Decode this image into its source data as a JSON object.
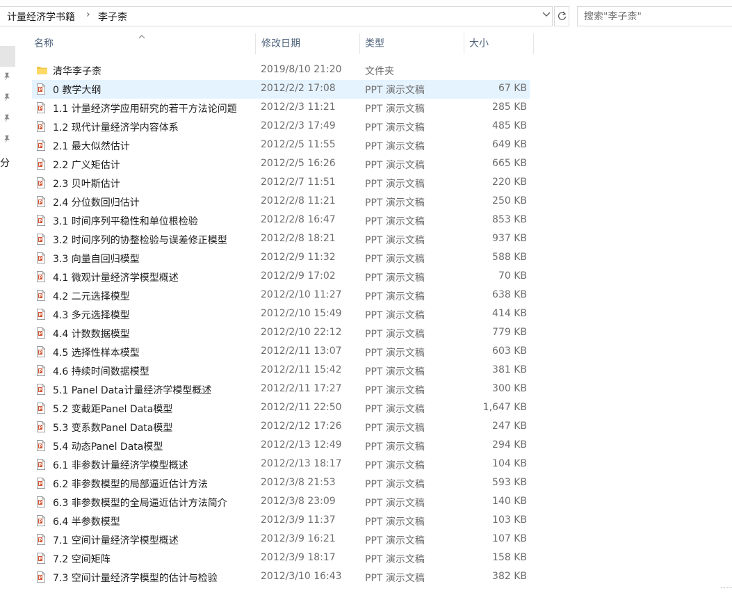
{
  "breadcrumb": {
    "items": [
      "计量经济学书籍",
      "李子柰"
    ],
    "separator": "›"
  },
  "search": {
    "placeholder": "搜索\"李子柰\""
  },
  "nav": {
    "partial_label": "分"
  },
  "columns": {
    "name": "名称",
    "date": "修改日期",
    "type": "类型",
    "size": "大小"
  },
  "colors": {
    "selected_row": "#e5f3ff",
    "header_text": "#4c607a",
    "ppt_icon": "#d35230",
    "folder": "#f0c84a"
  },
  "files": [
    {
      "name": "清华李子柰",
      "date": "2019/8/10 21:20",
      "type": "文件夹",
      "size": "",
      "icon": "folder-icon"
    },
    {
      "name": "0 教学大纲",
      "date": "2012/2/2 17:08",
      "type": "PPT 演示文稿",
      "size": "67 KB",
      "icon": "ppt-file-icon",
      "selected": true
    },
    {
      "name": "1.1 计量经济学应用研究的若干方法论问题",
      "date": "2012/2/3 11:21",
      "type": "PPT 演示文稿",
      "size": "285 KB",
      "icon": "ppt-file-icon"
    },
    {
      "name": "1.2 现代计量经济学内容体系",
      "date": "2012/2/3 17:49",
      "type": "PPT 演示文稿",
      "size": "485 KB",
      "icon": "ppt-file-icon"
    },
    {
      "name": "2.1 最大似然估计",
      "date": "2012/2/5 11:55",
      "type": "PPT 演示文稿",
      "size": "649 KB",
      "icon": "ppt-file-icon"
    },
    {
      "name": "2.2 广义矩估计",
      "date": "2012/2/5 16:26",
      "type": "PPT 演示文稿",
      "size": "665 KB",
      "icon": "ppt-file-icon"
    },
    {
      "name": "2.3 贝叶斯估计",
      "date": "2012/2/7 11:51",
      "type": "PPT 演示文稿",
      "size": "220 KB",
      "icon": "ppt-file-icon"
    },
    {
      "name": "2.4 分位数回归估计",
      "date": "2012/2/8 11:21",
      "type": "PPT 演示文稿",
      "size": "250 KB",
      "icon": "ppt-file-icon"
    },
    {
      "name": "3.1 时间序列平稳性和单位根检验",
      "date": "2012/2/8 16:47",
      "type": "PPT 演示文稿",
      "size": "853 KB",
      "icon": "ppt-file-icon"
    },
    {
      "name": "3.2 时间序列的协整检验与误差修正模型",
      "date": "2012/2/8 18:21",
      "type": "PPT 演示文稿",
      "size": "937 KB",
      "icon": "ppt-file-icon"
    },
    {
      "name": "3.3 向量自回归模型",
      "date": "2012/2/9 11:32",
      "type": "PPT 演示文稿",
      "size": "588 KB",
      "icon": "ppt-file-icon"
    },
    {
      "name": "4.1 微观计量经济学模型概述",
      "date": "2012/2/9 17:02",
      "type": "PPT 演示文稿",
      "size": "70 KB",
      "icon": "ppt-file-icon"
    },
    {
      "name": "4.2 二元选择模型",
      "date": "2012/2/10 11:27",
      "type": "PPT 演示文稿",
      "size": "638 KB",
      "icon": "ppt-file-icon"
    },
    {
      "name": "4.3 多元选择模型",
      "date": "2012/2/10 15:49",
      "type": "PPT 演示文稿",
      "size": "414 KB",
      "icon": "ppt-file-icon"
    },
    {
      "name": "4.4 计数数据模型",
      "date": "2012/2/10 22:12",
      "type": "PPT 演示文稿",
      "size": "779 KB",
      "icon": "ppt-file-icon"
    },
    {
      "name": "4.5 选择性样本模型",
      "date": "2012/2/11 13:07",
      "type": "PPT 演示文稿",
      "size": "603 KB",
      "icon": "ppt-file-icon"
    },
    {
      "name": "4.6 持续时间数据模型",
      "date": "2012/2/11 15:42",
      "type": "PPT 演示文稿",
      "size": "381 KB",
      "icon": "ppt-file-icon"
    },
    {
      "name": "5.1 Panel Data计量经济学模型概述",
      "date": "2012/2/11 17:27",
      "type": "PPT 演示文稿",
      "size": "300 KB",
      "icon": "ppt-file-icon"
    },
    {
      "name": "5.2 变截距Panel Data模型",
      "date": "2012/2/11 22:50",
      "type": "PPT 演示文稿",
      "size": "1,647 KB",
      "icon": "ppt-file-icon"
    },
    {
      "name": "5.3 变系数Panel Data模型",
      "date": "2012/2/12 17:26",
      "type": "PPT 演示文稿",
      "size": "247 KB",
      "icon": "ppt-file-icon"
    },
    {
      "name": "5.4 动态Panel Data模型",
      "date": "2012/2/13 12:49",
      "type": "PPT 演示文稿",
      "size": "294 KB",
      "icon": "ppt-file-icon"
    },
    {
      "name": "6.1 非参数计量经济学模型概述",
      "date": "2012/2/13 18:17",
      "type": "PPT 演示文稿",
      "size": "104 KB",
      "icon": "ppt-file-icon"
    },
    {
      "name": "6.2 非参数模型的局部逼近估计方法",
      "date": "2012/3/8 21:53",
      "type": "PPT 演示文稿",
      "size": "593 KB",
      "icon": "ppt-file-icon"
    },
    {
      "name": "6.3 非参数模型的全局逼近估计方法简介",
      "date": "2012/3/8 23:09",
      "type": "PPT 演示文稿",
      "size": "140 KB",
      "icon": "ppt-file-icon"
    },
    {
      "name": "6.4 半参数模型",
      "date": "2012/3/9 11:37",
      "type": "PPT 演示文稿",
      "size": "103 KB",
      "icon": "ppt-file-icon"
    },
    {
      "name": "7.1 空间计量经济学模型概述",
      "date": "2012/3/9 16:21",
      "type": "PPT 演示文稿",
      "size": "107 KB",
      "icon": "ppt-file-icon"
    },
    {
      "name": "7.2 空间矩阵",
      "date": "2012/3/9 18:17",
      "type": "PPT 演示文稿",
      "size": "158 KB",
      "icon": "ppt-file-icon"
    },
    {
      "name": "7.3 空间计量经济学模型的估计与检验",
      "date": "2012/3/10 16:43",
      "type": "PPT 演示文稿",
      "size": "382 KB",
      "icon": "ppt-file-icon"
    }
  ]
}
